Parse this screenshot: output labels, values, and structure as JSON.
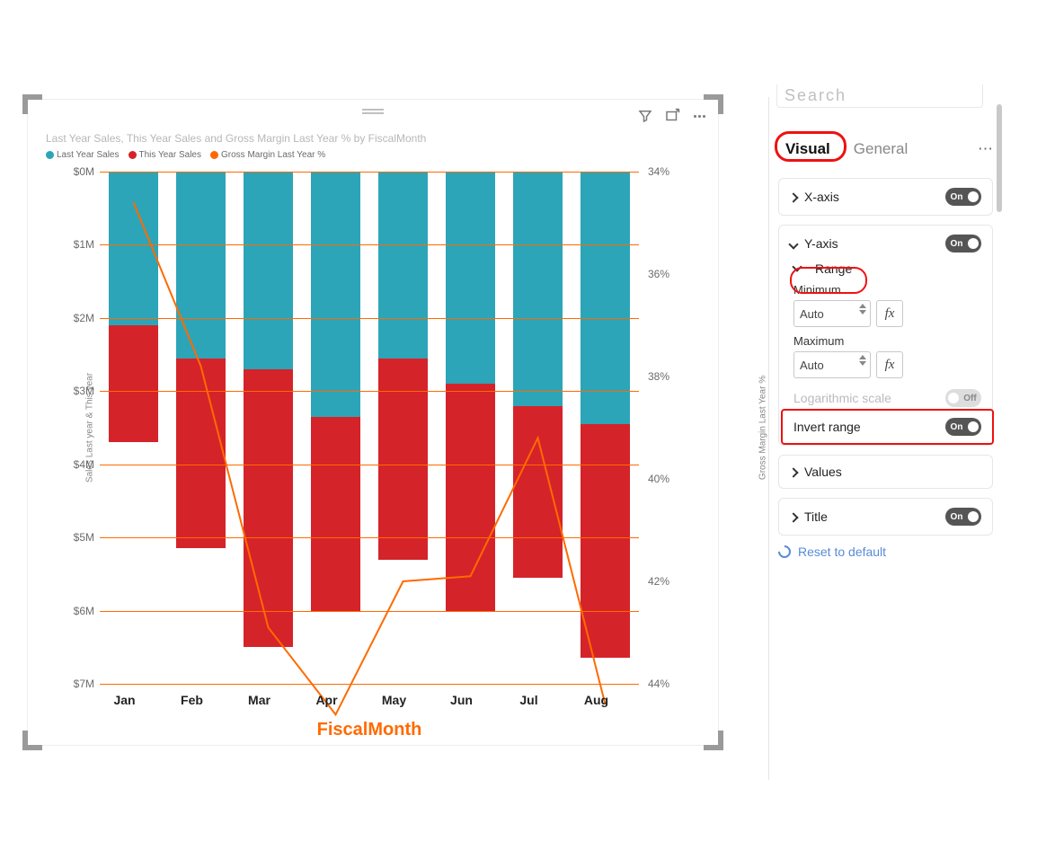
{
  "viz": {
    "title": "Last Year Sales, This Year Sales and Gross Margin Last Year % by FiscalMonth",
    "legend": {
      "s1": "Last Year Sales",
      "s2": "This Year Sales",
      "s3": "Gross Margin Last Year %"
    },
    "yleft_label": "Sales Last year & This year",
    "yright_label": "Gross Margin Last Year %",
    "xaxis_title": "FiscalMonth",
    "yleft_ticks": [
      "$0M",
      "$1M",
      "$2M",
      "$3M",
      "$4M",
      "$5M",
      "$6M",
      "$7M"
    ],
    "yright_ticks": [
      "34%",
      "36%",
      "38%",
      "40%",
      "42%",
      "44%"
    ],
    "xticks": [
      "Jan",
      "Feb",
      "Mar",
      "Apr",
      "May",
      "Jun",
      "Jul",
      "Aug"
    ]
  },
  "panel": {
    "search_stub": "Search",
    "tab_visual": "Visual",
    "tab_general": "General",
    "sections": {
      "xaxis": "X-axis",
      "yaxis": "Y-axis",
      "range_hdr": "Range",
      "minimum": "Minimum",
      "maximum": "Maximum",
      "auto": "Auto",
      "fx": "fx",
      "log_scale": "Logarithmic scale",
      "invert": "Invert range",
      "values": "Values",
      "title": "Title",
      "reset": "Reset to default"
    },
    "toggle_on": "On",
    "toggle_off": "Off"
  },
  "chart_data": {
    "type": "bar",
    "title": "Last Year Sales, This Year Sales and Gross Margin Last Year % by FiscalMonth",
    "categories": [
      "Jan",
      "Feb",
      "Mar",
      "Apr",
      "May",
      "Jun",
      "Jul",
      "Aug"
    ],
    "series": [
      {
        "name": "Last Year Sales",
        "values": [
          2.1,
          2.55,
          2.7,
          3.35,
          2.55,
          2.9,
          3.2,
          3.45
        ],
        "color": "#2ca5b8"
      },
      {
        "name": "This Year Sales",
        "values": [
          1.6,
          2.6,
          3.8,
          2.65,
          2.75,
          3.1,
          2.35,
          3.2
        ],
        "color": "#d5232a"
      },
      {
        "name": "Gross Margin Last Year %",
        "values": [
          34.6,
          37.8,
          42.9,
          44.6,
          42.0,
          41.9,
          39.2,
          44.4
        ],
        "color": "#ff6a00",
        "type": "line",
        "y_axis": "right"
      }
    ],
    "y_axis_left": {
      "label": "Sales Last year & This year",
      "min": 0,
      "max": 7,
      "unit": "$M",
      "inverted": true
    },
    "y_axis_right": {
      "label": "Gross Margin Last Year %",
      "min": 34,
      "max": 44,
      "unit": "%"
    },
    "x_axis": {
      "label": "FiscalMonth"
    }
  }
}
